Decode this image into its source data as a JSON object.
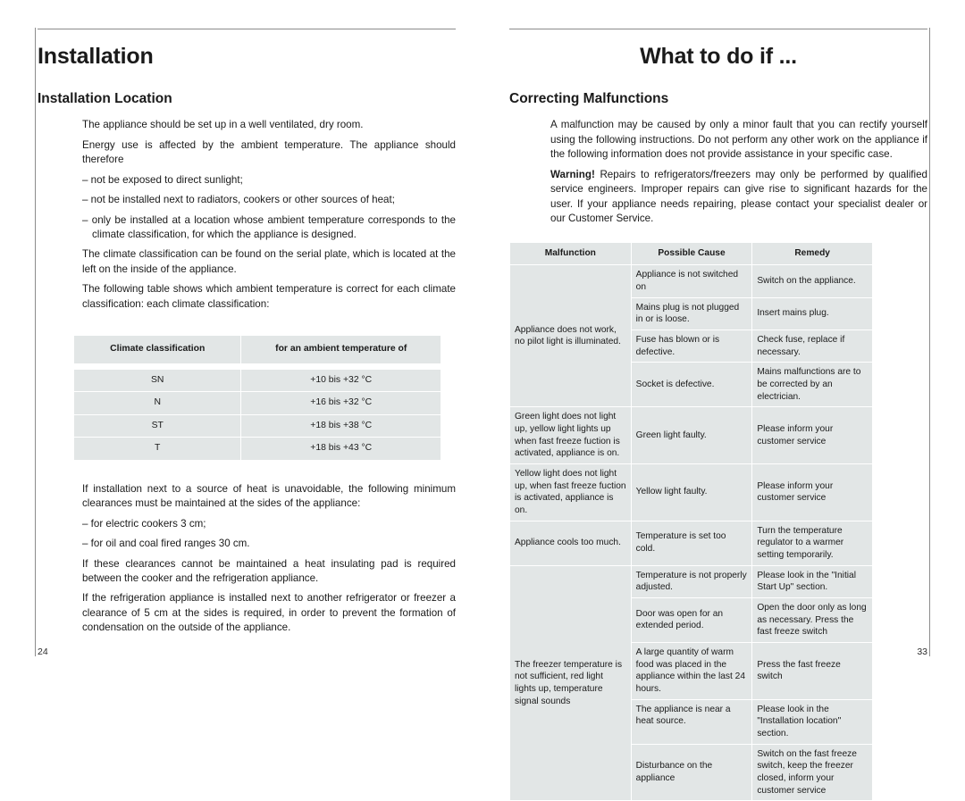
{
  "left_page": {
    "folio": "24",
    "title": "Installation",
    "section_heading": "Installation Location",
    "paragraphs": [
      "The appliance should be set up in a well ventilated, dry room.",
      "Energy use is affected by the ambient temperature. The appliance should therefore"
    ],
    "bullets": [
      "– not be exposed to direct sunlight;",
      "– not be installed next to radiators, cookers or other sources of heat;",
      "– only be installed at a location whose ambient temperature corresponds to the climate classification, for which the appliance is designed."
    ],
    "paragraphs2": [
      "The climate classification can be found on the serial plate, which is located at the left on the inside of the appliance.",
      "The following table shows which ambient temperature is correct for each climate classification: each climate classification:"
    ],
    "climate_table": {
      "headers": [
        "Climate classification",
        "for an ambient temperature of"
      ],
      "rows": [
        [
          "SN",
          "+10 bis +32 °C"
        ],
        [
          "N",
          "+16 bis +32 °C"
        ],
        [
          "ST",
          "+18 bis +38 °C"
        ],
        [
          "T",
          "+18 bis +43 °C"
        ]
      ]
    },
    "paragraphs3": [
      "If installation next to a source of heat is unavoidable, the following minimum clearances must be maintained at the sides of the appliance:"
    ],
    "bullets2": [
      "– for electric cookers 3 cm;",
      "– for oil and coal fired ranges 30 cm."
    ],
    "paragraphs4": [
      "If these clearances cannot be maintained a heat insulating pad is required between the cooker and the refrigeration appliance.",
      "If the refrigeration appliance is installed next to another refrigerator or freezer a clearance of 5 cm at the sides is required, in order to prevent the formation of condensation on the outside of the appliance."
    ]
  },
  "right_page": {
    "folio": "33",
    "title": "What to do if ...",
    "section_heading": "Correcting Malfunctions",
    "intro": "A malfunction may be caused by only a minor fault that you can rectify yourself using the following instructions. Do not perform any other work on the appliance if the following information does not provide assistance in your specific case.",
    "warning_label": "Warning!",
    "warning_text": " Repairs to refrigerators/freezers may only be performed by qualified service engineers. Improper repairs can give rise to significant hazards for the user. If your appliance needs repairing, please contact your specialist dealer or our Customer Service.",
    "malfunction_table": {
      "headers": [
        "Malfunction",
        "Possible Cause",
        "Remedy"
      ],
      "groups": [
        {
          "malfunction": "Appliance does not work, no pilot light is illuminated.",
          "rows": [
            {
              "cause": "Appliance is not switched on",
              "remedy": "Switch on the appliance."
            },
            {
              "cause": "Mains plug is not plugged in or is loose.",
              "remedy": "Insert mains plug."
            },
            {
              "cause": "Fuse has blown or is defective.",
              "remedy": "Check fuse, replace if necessary."
            },
            {
              "cause": "Socket is defective.",
              "remedy": "Mains malfunctions are to be corrected by an electrician."
            }
          ]
        },
        {
          "malfunction": "Green light does not light up, yellow light lights up when fast freeze fuction is activated, appliance is on.",
          "rows": [
            {
              "cause": "Green light faulty.",
              "remedy": "Please inform your customer service"
            }
          ]
        },
        {
          "malfunction": "Yellow light does not light up, when fast freeze fuction is activated, appliance is on.",
          "rows": [
            {
              "cause": "Yellow light faulty.",
              "remedy": "Please inform your customer service"
            }
          ]
        },
        {
          "malfunction": "Appliance cools too much.",
          "rows": [
            {
              "cause": "Temperature is set too cold.",
              "remedy": "Turn the temperature regulator to a warmer setting temporarily."
            }
          ]
        },
        {
          "malfunction": "The freezer temperature is not sufficient, red light lights up, temperature signal sounds",
          "rows": [
            {
              "cause": "Temperature is not properly adjusted.",
              "remedy": "Please look in the \"Initial Start Up\" section."
            },
            {
              "cause": "Door was open for an extended period.",
              "remedy": "Open the door only as long as necessary. Press the fast freeze switch"
            },
            {
              "cause": "A large quantity of warm food was placed in the appliance within the last 24 hours.",
              "remedy": "Press the fast freeze switch"
            },
            {
              "cause": "The appliance is near a heat source.",
              "remedy": "Please look in the \"Installation location\" section."
            },
            {
              "cause": "Disturbance on the appliance",
              "remedy": "Switch on the fast freeze switch, keep the freezer closed, inform your customer service"
            }
          ]
        }
      ]
    }
  }
}
